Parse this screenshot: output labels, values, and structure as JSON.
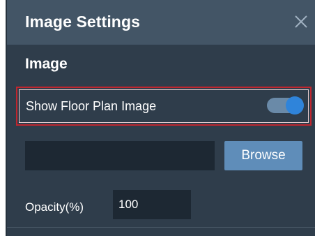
{
  "dialog": {
    "title": "Image Settings",
    "close_icon": "close-icon"
  },
  "section": {
    "title": "Image"
  },
  "toggle": {
    "label": "Show Floor Plan Image",
    "state": "on"
  },
  "file": {
    "value": "",
    "browse_label": "Browse"
  },
  "opacity": {
    "label": "Opacity(%)",
    "value": "100"
  },
  "colors": {
    "panel_bg": "#2f3d4b",
    "header_bg": "#435566",
    "accent": "#2f84da",
    "button_bg": "#5f8db9",
    "highlight_border": "#c0262e"
  }
}
